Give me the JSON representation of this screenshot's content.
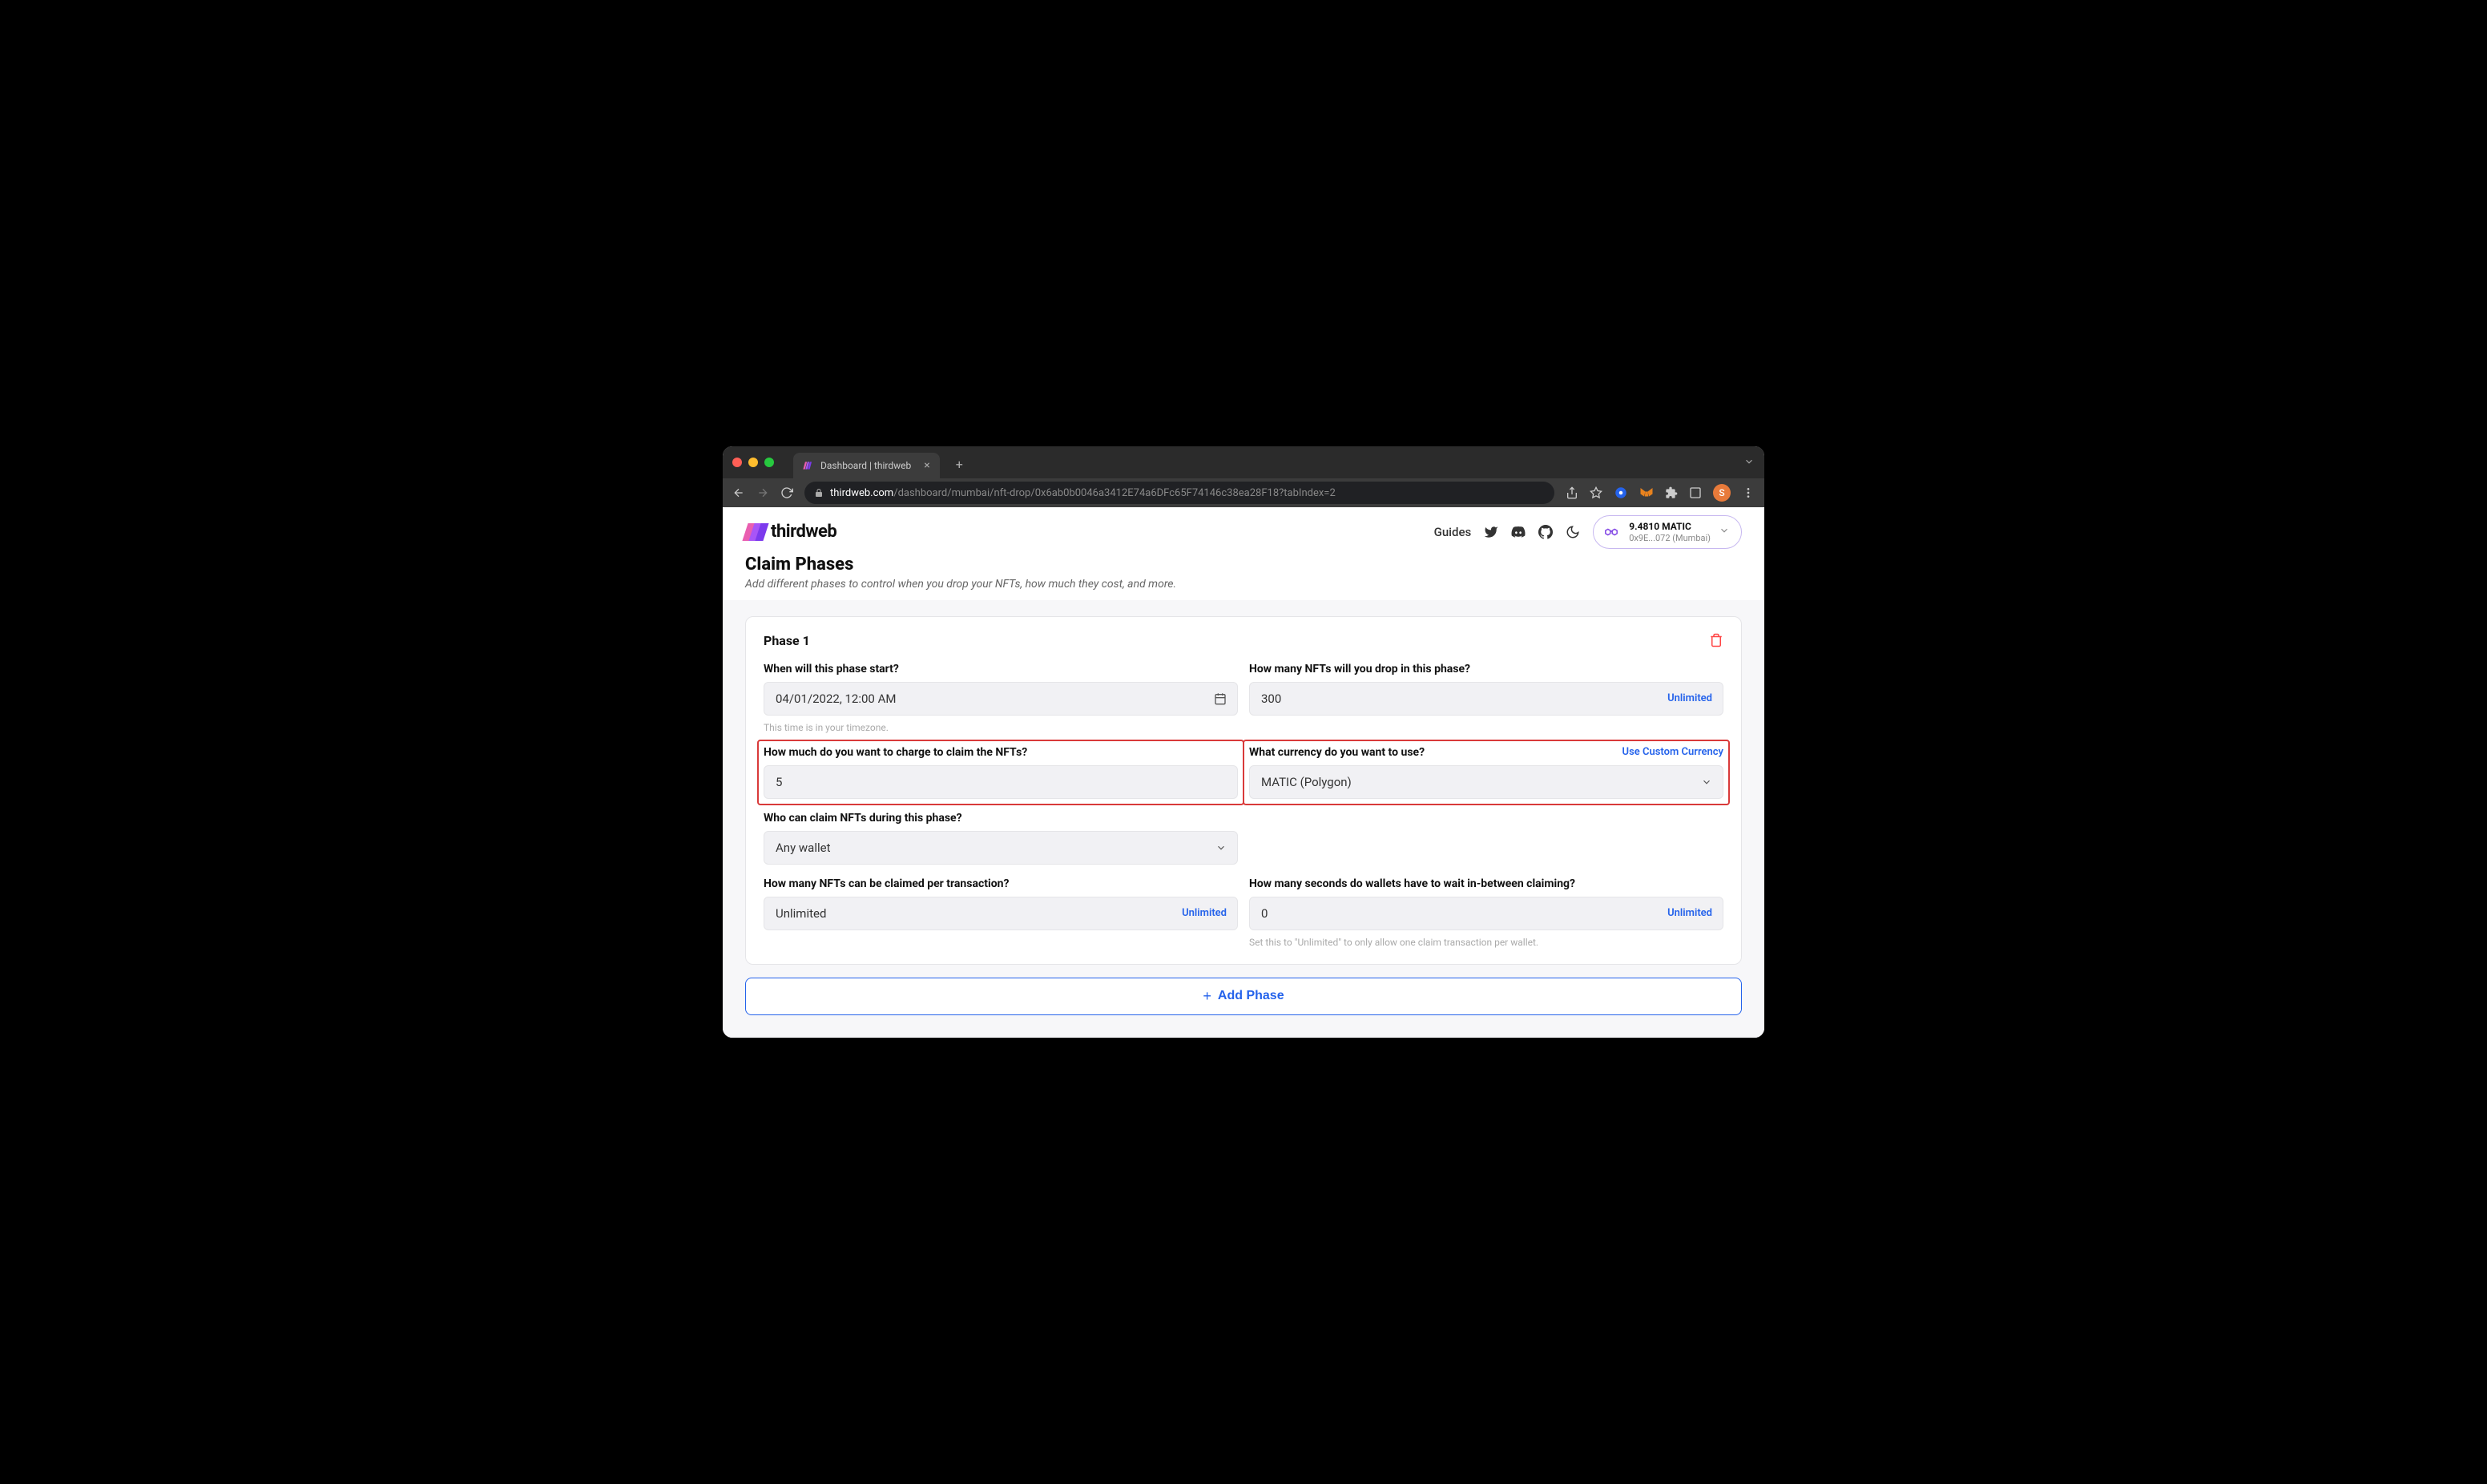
{
  "browser": {
    "tab_title": "Dashboard | thirdweb",
    "url_domain": "thirdweb.com",
    "url_path": "/dashboard/mumbai/nft-drop/0x6ab0b0046a3412E74a6DFc65F74146c38ea28F18?tabIndex=2",
    "avatar_letter": "S"
  },
  "header": {
    "logo_text": "thirdweb",
    "guides": "Guides",
    "wallet": {
      "balance": "9.4810 MATIC",
      "address": "0x9E...072 (Mumbai)"
    }
  },
  "section": {
    "title": "Claim Phases",
    "subtitle": "Add different phases to control when you drop your NFTs, how much they cost, and more."
  },
  "phase": {
    "title": "Phase 1",
    "fields": {
      "start": {
        "label": "When will this phase start?",
        "value": "04/01/2022, 12:00 AM",
        "help": "This time is in your timezone."
      },
      "supply": {
        "label": "How many NFTs will you drop in this phase?",
        "value": "300",
        "action": "Unlimited"
      },
      "price": {
        "label": "How much do you want to charge to claim the NFTs?",
        "value": "5"
      },
      "currency": {
        "label": "What currency do you want to use?",
        "value": "MATIC (Polygon)",
        "action": "Use Custom Currency"
      },
      "who": {
        "label": "Who can claim NFTs during this phase?",
        "value": "Any wallet"
      },
      "per_tx": {
        "label": "How many NFTs can be claimed per transaction?",
        "value": "Unlimited",
        "action": "Unlimited"
      },
      "wait": {
        "label": "How many seconds do wallets have to wait in-between claiming?",
        "value": "0",
        "action": "Unlimited",
        "help": "Set this to \"Unlimited\" to only allow one claim transaction per wallet."
      }
    }
  },
  "add_phase": "Add Phase"
}
